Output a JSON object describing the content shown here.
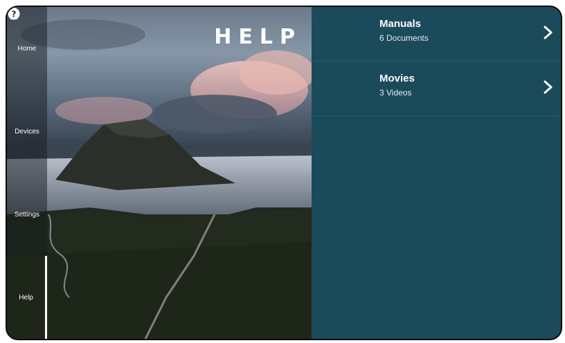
{
  "screen": {
    "title": "HELP"
  },
  "sidebar": {
    "items": [
      {
        "label": "Home",
        "icon": "home-icon"
      },
      {
        "label": "Devices",
        "icon": "lightbulb-icon"
      },
      {
        "label": "Settings",
        "icon": "gear-icon"
      },
      {
        "label": "Help",
        "icon": "question-icon"
      }
    ],
    "active": "Help"
  },
  "help_menu": {
    "items": [
      {
        "title": "Manuals",
        "subtitle": "6 Documents",
        "icon": "chevron-right-icon"
      },
      {
        "title": "Movies",
        "subtitle": "3 Videos",
        "icon": "chevron-right-icon"
      }
    ]
  },
  "colors": {
    "panel": "#1b4a5b",
    "divider": "#2a5a6a",
    "text": "#ffffff"
  }
}
